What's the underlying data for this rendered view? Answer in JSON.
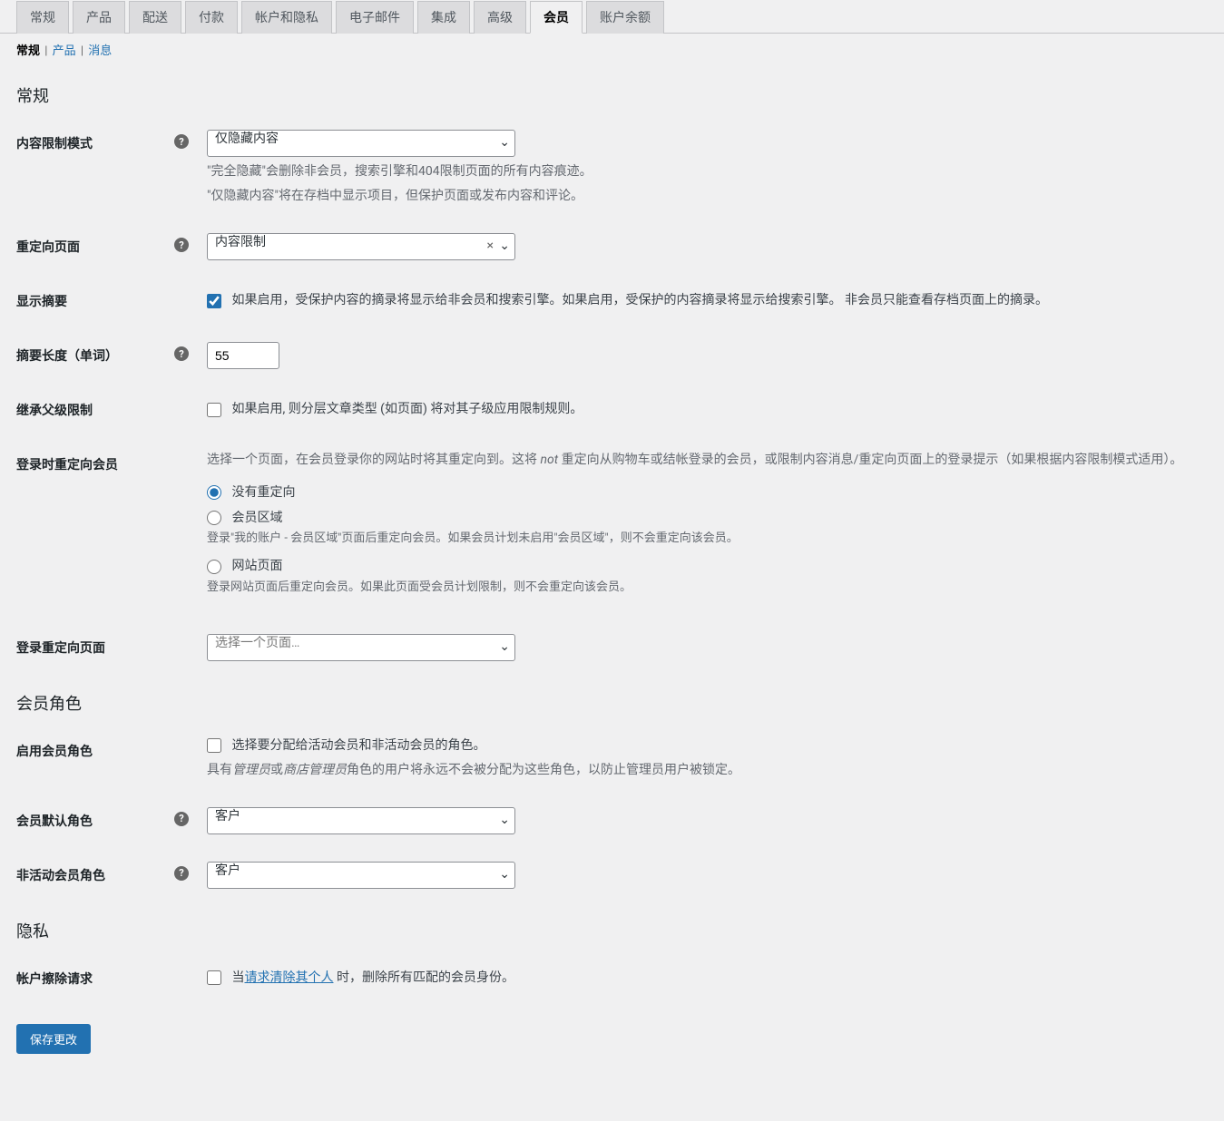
{
  "nav_tabs": {
    "items": [
      "常规",
      "产品",
      "配送",
      "付款",
      "帐户和隐私",
      "电子邮件",
      "集成",
      "高级",
      "会员",
      "账户余额"
    ],
    "active_index": 8
  },
  "sub_nav": {
    "items": [
      "常规",
      "产品",
      "消息"
    ],
    "active_index": 0
  },
  "sections": {
    "general_heading": "常规",
    "member_roles_heading": "会员角色",
    "privacy_heading": "隐私"
  },
  "content_restriction_mode": {
    "label": "内容限制模式",
    "value": "仅隐藏内容",
    "desc_line1": "\"完全隐藏\"会删除非会员，搜索引擎和404限制页面的所有内容痕迹。",
    "desc_line2": "\"仅隐藏内容\"将在存档中显示项目，但保护页面或发布内容和评论。"
  },
  "redirect_page": {
    "label": "重定向页面",
    "value": "内容限制"
  },
  "show_excerpt": {
    "label": "显示摘要",
    "checked": true,
    "text": "如果启用，受保护内容的摘录将显示给非会员和搜索引擎。如果启用，受保护的内容摘录将显示给搜索引擎。 非会员只能查看存档页面上的摘录。"
  },
  "excerpt_length": {
    "label": "摘要长度（单词）",
    "value": "55"
  },
  "inherit_parent": {
    "label": "继承父级限制",
    "checked": false,
    "text": "如果启用, 则分层文章类型 (如页面) 将对其子级应用限制规则。"
  },
  "login_redirect": {
    "label": "登录时重定向会员",
    "intro_pre": "选择一个页面，在会员登录你的网站时将其重定向到。这将 ",
    "intro_em": "not",
    "intro_post": " 重定向从购物车或结帐登录的会员，或限制内容消息/重定向页面上的登录提示（如果根据内容限制模式适用）。",
    "options": {
      "none": "没有重定向",
      "member_area": "会员区域",
      "member_area_desc": "登录\"我的账户 - 会员区域\"页面后重定向会员。如果会员计划未启用\"会员区域\"，则不会重定向该会员。",
      "site_page": "网站页面",
      "site_page_desc": "登录网站页面后重定向会员。如果此页面受会员计划限制，则不会重定向该会员。"
    },
    "selected": "none"
  },
  "login_redirect_page": {
    "label": "登录重定向页面",
    "placeholder": "选择一个页面…"
  },
  "enable_member_roles": {
    "label": "启用会员角色",
    "checked": false,
    "text": "选择要分配给活动会员和非活动会员的角色。",
    "desc_pre": "具有",
    "desc_em1": "管理员",
    "desc_mid": "或",
    "desc_em2": "商店管理员",
    "desc_post": "角色的用户将永远不会被分配为这些角色，以防止管理员用户被锁定。"
  },
  "default_member_role": {
    "label": "会员默认角色",
    "value": "客户"
  },
  "inactive_member_role": {
    "label": "非活动会员角色",
    "value": "客户"
  },
  "account_erasure": {
    "label": "帐户擦除请求",
    "checked": false,
    "text_pre": "当",
    "link": "请求清除其个人",
    "text_post": " 时，删除所有匹配的会员身份。"
  },
  "save_button": "保存更改"
}
